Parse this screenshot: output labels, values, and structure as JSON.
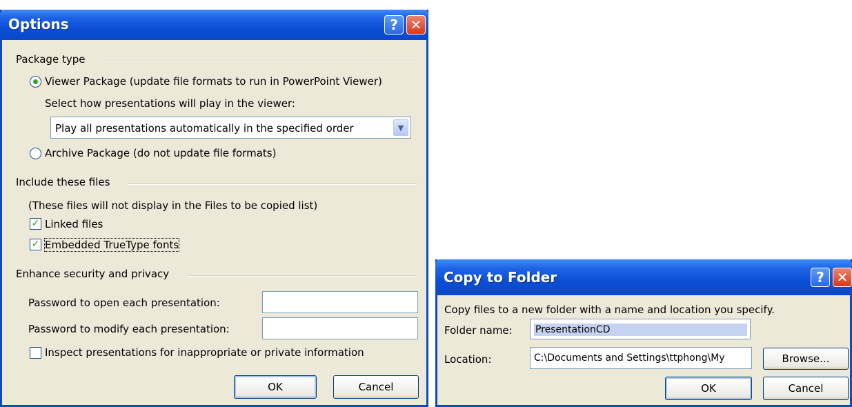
{
  "options": {
    "title": "Options",
    "package_type": {
      "heading": "Package type",
      "viewer_label": "Viewer Package (update file formats to run in PowerPoint Viewer)",
      "viewer_selected": true,
      "select_label": "Select how presentations will play in the viewer:",
      "play_value": "Play all presentations automatically in the specified order",
      "archive_label": "Archive Package (do not update file formats)",
      "archive_selected": false
    },
    "include": {
      "heading": "Include these files",
      "note": "(These files will not display in the Files to be copied list)",
      "linked_label": "Linked files",
      "linked_checked": true,
      "embedded_label": "Embedded TrueType fonts",
      "embedded_checked": true
    },
    "security": {
      "heading": "Enhance security and privacy",
      "open_label": "Password to open each presentation:",
      "open_value": "",
      "modify_label": "Password to modify each presentation:",
      "modify_value": "",
      "inspect_label": "Inspect presentations for inappropriate or private information",
      "inspect_checked": false
    },
    "ok_label": "OK",
    "cancel_label": "Cancel"
  },
  "copy_to_folder": {
    "title": "Copy to Folder",
    "description": "Copy files to a new folder with a name and location you specify.",
    "folder_name_label": "Folder name:",
    "folder_name_value": "PresentationCD",
    "location_label": "Location:",
    "location_value": "C:\\Documents and Settings\\ttphong\\My",
    "browse_label": "Browse...",
    "ok_label": "OK",
    "cancel_label": "Cancel"
  },
  "colors": {
    "titlebar": "#0a4ad0",
    "dialog_face": "#ece9d8",
    "close_button": "#d9381a",
    "check_green": "#22a322"
  },
  "icons": [
    "help-icon",
    "close-icon",
    "chevron-down-icon",
    "checkmark-icon"
  ]
}
